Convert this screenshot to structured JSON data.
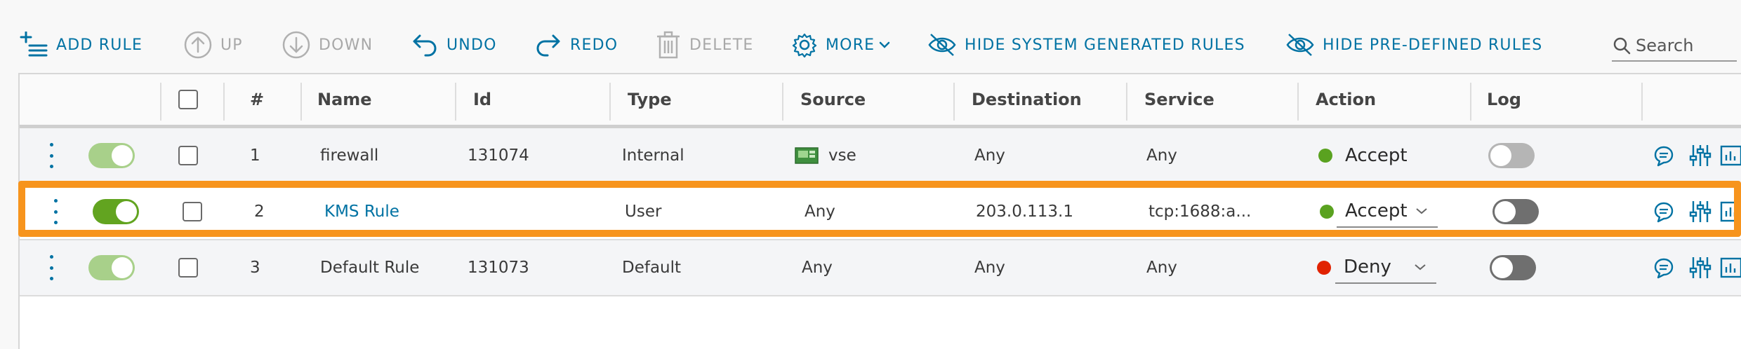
{
  "toolbar": {
    "add_rule": "ADD RULE",
    "up": "UP",
    "down": "DOWN",
    "undo": "UNDO",
    "redo": "REDO",
    "delete": "DELETE",
    "more": "MORE",
    "hide_system": "HIDE SYSTEM GENERATED RULES",
    "hide_predefined": "HIDE PRE-DEFINED RULES",
    "search_placeholder": "Search"
  },
  "columns": {
    "num": "#",
    "name": "Name",
    "id": "Id",
    "type": "Type",
    "source": "Source",
    "destination": "Destination",
    "service": "Service",
    "action": "Action",
    "log": "Log"
  },
  "rows": [
    {
      "num": "1",
      "name": "firewall",
      "id": "131074",
      "type": "Internal",
      "source": "vse",
      "destination": "Any",
      "service": "Any",
      "action": "Accept",
      "enabled": true,
      "log": false
    },
    {
      "num": "2",
      "name": "KMS Rule",
      "id": "",
      "type": "User",
      "source": "Any",
      "destination": "203.0.113.1",
      "service": "tcp:1688:a...",
      "action": "Accept",
      "enabled": true,
      "log": false
    },
    {
      "num": "3",
      "name": "Default Rule",
      "id": "131073",
      "type": "Default",
      "source": "Any",
      "destination": "Any",
      "service": "Any",
      "action": "Deny",
      "enabled": true,
      "log": false
    }
  ],
  "colors": {
    "accent": "#0072a3",
    "accept": "#5aa220",
    "deny": "#e12200",
    "highlight": "#f7941d"
  }
}
